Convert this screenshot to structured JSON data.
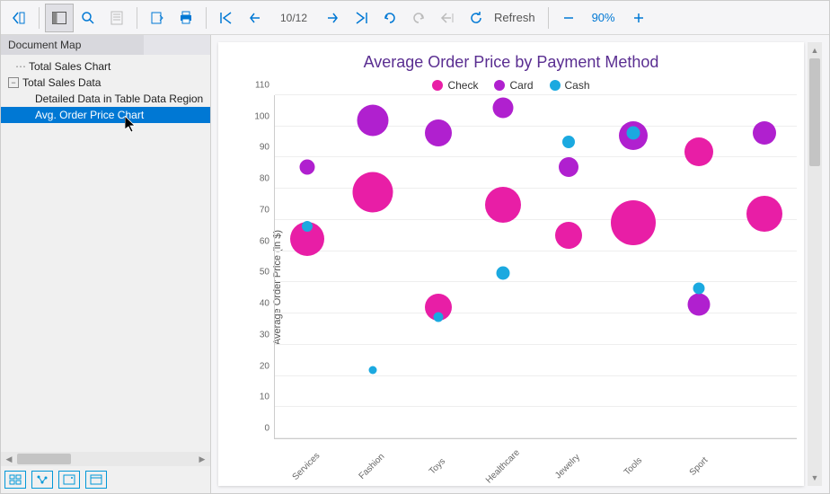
{
  "toolbar": {
    "page_indicator": "10/12",
    "refresh_label": "Refresh",
    "zoom_label": "90%"
  },
  "sidebar": {
    "title": "Document Map",
    "items": [
      {
        "label": "Total Sales Chart",
        "level": 1,
        "expandable": false
      },
      {
        "label": "Total Sales Data",
        "level": 0,
        "expandable": true,
        "expanded": true
      },
      {
        "label": "Detailed Data in Table Data Region",
        "level": 2,
        "expandable": false
      },
      {
        "label": "Avg. Order Price Chart",
        "level": 2,
        "expandable": false,
        "selected": true
      }
    ]
  },
  "colors": {
    "check": "#e81ea6",
    "card": "#b020cf",
    "cash": "#1ba9e0"
  },
  "chart_data": {
    "type": "bubble",
    "title": "Average Order Price by Payment Method",
    "ylabel": "Average Order Price (in $)",
    "xlabel": "",
    "ylim": [
      0,
      110
    ],
    "yticks": [
      0,
      10,
      20,
      30,
      40,
      50,
      60,
      70,
      80,
      90,
      100,
      110
    ],
    "categories": [
      "Services",
      "Fashion",
      "Toys",
      "Healthcare",
      "Jewelry",
      "Tools",
      "Sport",
      ""
    ],
    "legend": [
      {
        "name": "Check",
        "color_key": "check"
      },
      {
        "name": "Card",
        "color_key": "card"
      },
      {
        "name": "Cash",
        "color_key": "cash"
      }
    ],
    "series": [
      {
        "name": "Check",
        "color_key": "check",
        "points": [
          {
            "x": 0,
            "y": 64,
            "size": 38
          },
          {
            "x": 1,
            "y": 79,
            "size": 45
          },
          {
            "x": 2,
            "y": 42,
            "size": 30
          },
          {
            "x": 3,
            "y": 75,
            "size": 40
          },
          {
            "x": 4,
            "y": 65,
            "size": 30
          },
          {
            "x": 5,
            "y": 69,
            "size": 50
          },
          {
            "x": 6,
            "y": 92,
            "size": 32
          },
          {
            "x": 7,
            "y": 72,
            "size": 40
          }
        ]
      },
      {
        "name": "Card",
        "color_key": "card",
        "points": [
          {
            "x": 0,
            "y": 87,
            "size": 17
          },
          {
            "x": 1,
            "y": 102,
            "size": 35
          },
          {
            "x": 2,
            "y": 98,
            "size": 30
          },
          {
            "x": 3,
            "y": 106,
            "size": 23
          },
          {
            "x": 4,
            "y": 87,
            "size": 22
          },
          {
            "x": 5,
            "y": 97,
            "size": 32
          },
          {
            "x": 6,
            "y": 43,
            "size": 25
          },
          {
            "x": 7,
            "y": 98,
            "size": 26
          }
        ]
      },
      {
        "name": "Cash",
        "color_key": "cash",
        "points": [
          {
            "x": 0,
            "y": 68,
            "size": 12
          },
          {
            "x": 1,
            "y": 22,
            "size": 9
          },
          {
            "x": 2,
            "y": 39,
            "size": 11
          },
          {
            "x": 3,
            "y": 53,
            "size": 15
          },
          {
            "x": 4,
            "y": 95,
            "size": 14
          },
          {
            "x": 5,
            "y": 98,
            "size": 15
          },
          {
            "x": 6,
            "y": 48,
            "size": 13
          }
        ]
      }
    ]
  }
}
